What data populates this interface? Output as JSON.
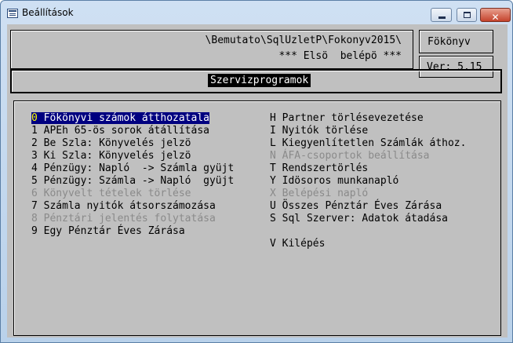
{
  "window": {
    "title": "Beállítások",
    "controls": {
      "minimize": "",
      "maximize": "",
      "close": "✕"
    }
  },
  "header": {
    "path": "\\Bemutato\\SqlUzletP\\Fokonyv2015\\",
    "status": "*** Elsö  belépö ***",
    "company": "Fökönyv",
    "version": "Ver: 5.15",
    "title": "Szervizprogramok"
  },
  "menu": {
    "left": [
      {
        "key": "0",
        "label": "Fökönyvi számok átthozatala",
        "state": "selected"
      },
      {
        "key": "1",
        "label": "APEh 65-ös sorok átállítása",
        "state": "enabled"
      },
      {
        "key": "2",
        "label": "Be Szla: Könyvelés jelzö",
        "state": "enabled"
      },
      {
        "key": "3",
        "label": "Ki Szla: Könyvelés jelzö",
        "state": "enabled"
      },
      {
        "key": "4",
        "label": "Pénzügy: Napló  -> Számla gyüjt",
        "state": "enabled"
      },
      {
        "key": "5",
        "label": "Pénzügy: Számla -> Napló  gyüjt",
        "state": "enabled"
      },
      {
        "key": "6",
        "label": "Könyvelt tételek törlése",
        "state": "disabled"
      },
      {
        "key": "7",
        "label": "Számla nyitók átsorszámozása",
        "state": "enabled"
      },
      {
        "key": "8",
        "label": "Pénztári jelentés folytatása",
        "state": "disabled"
      },
      {
        "key": "9",
        "label": "Egy Pénztár Éves Zárása",
        "state": "enabled"
      }
    ],
    "right": [
      {
        "key": "H",
        "label": "Partner törlésevezetése",
        "state": "enabled"
      },
      {
        "key": "I",
        "label": "Nyitók törlése",
        "state": "enabled"
      },
      {
        "key": "L",
        "label": "Kiegyenlítetlen Számlák áthoz.",
        "state": "enabled"
      },
      {
        "key": "N",
        "label": "ÁFA-csoportok beállítása",
        "state": "disabled"
      },
      {
        "key": "T",
        "label": "Rendszertörlés",
        "state": "enabled"
      },
      {
        "key": "Y",
        "label": "Idösoros munkanapló",
        "state": "enabled"
      },
      {
        "key": "X",
        "label": "Belépési napló",
        "state": "disabled"
      },
      {
        "key": "U",
        "label": "Összes Pénztár Éves Zárása",
        "state": "enabled"
      },
      {
        "key": "S",
        "label": "Sql Szerver: Adatok átadása",
        "state": "enabled"
      },
      {
        "key": "V",
        "label": "Kilépés",
        "state": "enabled"
      }
    ]
  }
}
